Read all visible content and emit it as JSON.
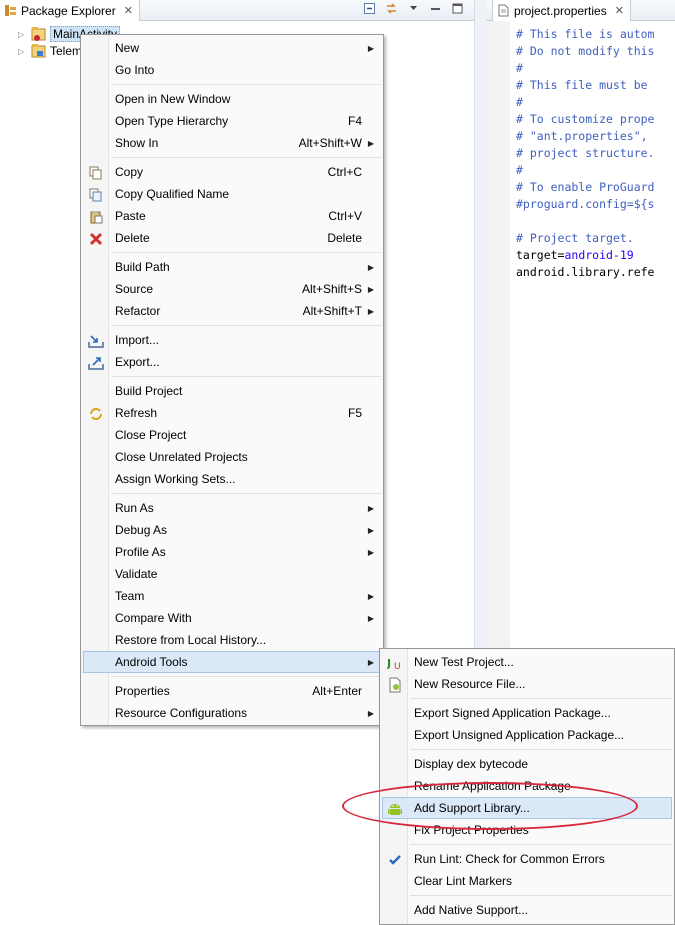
{
  "package_explorer": {
    "tab_title": "Package Explorer",
    "tree": [
      {
        "label": "MainActivity",
        "selected": true
      },
      {
        "label": "Telem",
        "selected": false
      }
    ]
  },
  "editor": {
    "tab_title": "project.properties",
    "lines": [
      {
        "text": "# This file is autom",
        "kind": "comment"
      },
      {
        "text": "# Do not modify this",
        "kind": "comment"
      },
      {
        "text": "#",
        "kind": "comment"
      },
      {
        "text": "# This file must be",
        "kind": "comment"
      },
      {
        "text": "#",
        "kind": "comment"
      },
      {
        "text": "# To customize prope",
        "kind": "comment"
      },
      {
        "text": "# \"ant.properties\",",
        "kind": "comment"
      },
      {
        "text": "# project structure.",
        "kind": "comment"
      },
      {
        "text": "#",
        "kind": "comment"
      },
      {
        "text": "# To enable ProGuard",
        "kind": "comment"
      },
      {
        "text": "#proguard.config=${s",
        "kind": "comment"
      },
      {
        "text": "",
        "kind": "plain"
      },
      {
        "text": "# Project target.",
        "kind": "comment"
      },
      {
        "key": "target=",
        "value": "android-19",
        "kind": "keyval"
      },
      {
        "text": "android.library.refe",
        "kind": "plain"
      }
    ]
  },
  "context_menu": {
    "items": [
      {
        "label": "New",
        "submenu": true
      },
      {
        "label": "Go Into"
      },
      {
        "separator": true
      },
      {
        "label": "Open in New Window"
      },
      {
        "label": "Open Type Hierarchy",
        "accel": "F4"
      },
      {
        "label": "Show In",
        "accel": "Alt+Shift+W",
        "submenu": true
      },
      {
        "separator": true
      },
      {
        "label": "Copy",
        "accel": "Ctrl+C",
        "icon": "copy-icon"
      },
      {
        "label": "Copy Qualified Name",
        "icon": "copy-qualified-icon"
      },
      {
        "label": "Paste",
        "accel": "Ctrl+V",
        "icon": "paste-icon"
      },
      {
        "label": "Delete",
        "accel": "Delete",
        "icon": "delete-icon"
      },
      {
        "separator": true
      },
      {
        "label": "Build Path",
        "submenu": true
      },
      {
        "label": "Source",
        "accel": "Alt+Shift+S",
        "submenu": true
      },
      {
        "label": "Refactor",
        "accel": "Alt+Shift+T",
        "submenu": true
      },
      {
        "separator": true
      },
      {
        "label": "Import...",
        "icon": "import-icon"
      },
      {
        "label": "Export...",
        "icon": "export-icon"
      },
      {
        "separator": true
      },
      {
        "label": "Build Project"
      },
      {
        "label": "Refresh",
        "accel": "F5",
        "icon": "refresh-icon"
      },
      {
        "label": "Close Project"
      },
      {
        "label": "Close Unrelated Projects"
      },
      {
        "label": "Assign Working Sets..."
      },
      {
        "separator": true
      },
      {
        "label": "Run As",
        "submenu": true
      },
      {
        "label": "Debug As",
        "submenu": true
      },
      {
        "label": "Profile As",
        "submenu": true
      },
      {
        "label": "Validate"
      },
      {
        "label": "Team",
        "submenu": true
      },
      {
        "label": "Compare With",
        "submenu": true
      },
      {
        "label": "Restore from Local History..."
      },
      {
        "label": "Android Tools",
        "submenu": true,
        "highlighted": true
      },
      {
        "separator": true
      },
      {
        "label": "Properties",
        "accel": "Alt+Enter"
      },
      {
        "label": "Resource Configurations",
        "submenu": true
      }
    ]
  },
  "android_tools_submenu": {
    "items": [
      {
        "label": "New Test Project...",
        "icon": "junit-icon"
      },
      {
        "label": "New Resource File...",
        "icon": "new-resource-icon"
      },
      {
        "separator": true
      },
      {
        "label": "Export Signed Application Package..."
      },
      {
        "label": "Export Unsigned Application Package..."
      },
      {
        "separator": true
      },
      {
        "label": "Display dex bytecode"
      },
      {
        "label": "Rename Application Package"
      },
      {
        "label": "Add Support Library...",
        "icon": "android-icon",
        "highlighted": true
      },
      {
        "label": "Fix Project Properties"
      },
      {
        "separator": true
      },
      {
        "label": "Run Lint: Check for Common Errors",
        "icon": "checkmark-icon"
      },
      {
        "label": "Clear Lint Markers"
      },
      {
        "separator": true
      },
      {
        "label": "Add Native Support..."
      }
    ]
  },
  "colors": {
    "highlight": "#dbe8f7",
    "annotation_ring": "#d8273c",
    "comment": "#3f5fbf",
    "string_value": "#2a00ff"
  }
}
